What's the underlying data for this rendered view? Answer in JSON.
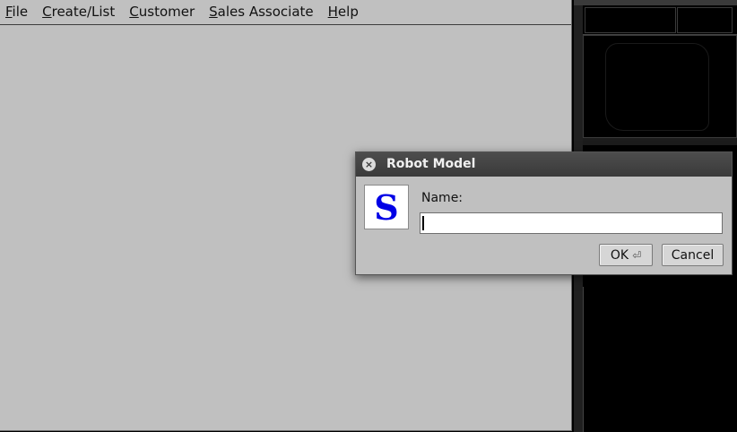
{
  "menubar": {
    "items": [
      {
        "mnemonic": "F",
        "rest": "ile"
      },
      {
        "mnemonic": "C",
        "rest": "reate/List"
      },
      {
        "mnemonic": "C",
        "rest": "ustomer"
      },
      {
        "mnemonic": "S",
        "rest": "ales Associate"
      },
      {
        "mnemonic": "H",
        "rest": "elp"
      }
    ]
  },
  "dialog": {
    "title": "Robot Model",
    "close_glyph": "×",
    "logo_letter": "S",
    "name_label": "Name:",
    "name_value": "",
    "ok_label": "OK",
    "enter_glyph": "⏎",
    "cancel_label": "Cancel"
  },
  "colors": {
    "app_background": "#c0c0c0",
    "dialog_titlebar": "#3a3a3a",
    "logo_letter": "#0000e6"
  },
  "icons": {
    "dialog_close": "close-icon",
    "ok_button": "enter-key-icon"
  }
}
